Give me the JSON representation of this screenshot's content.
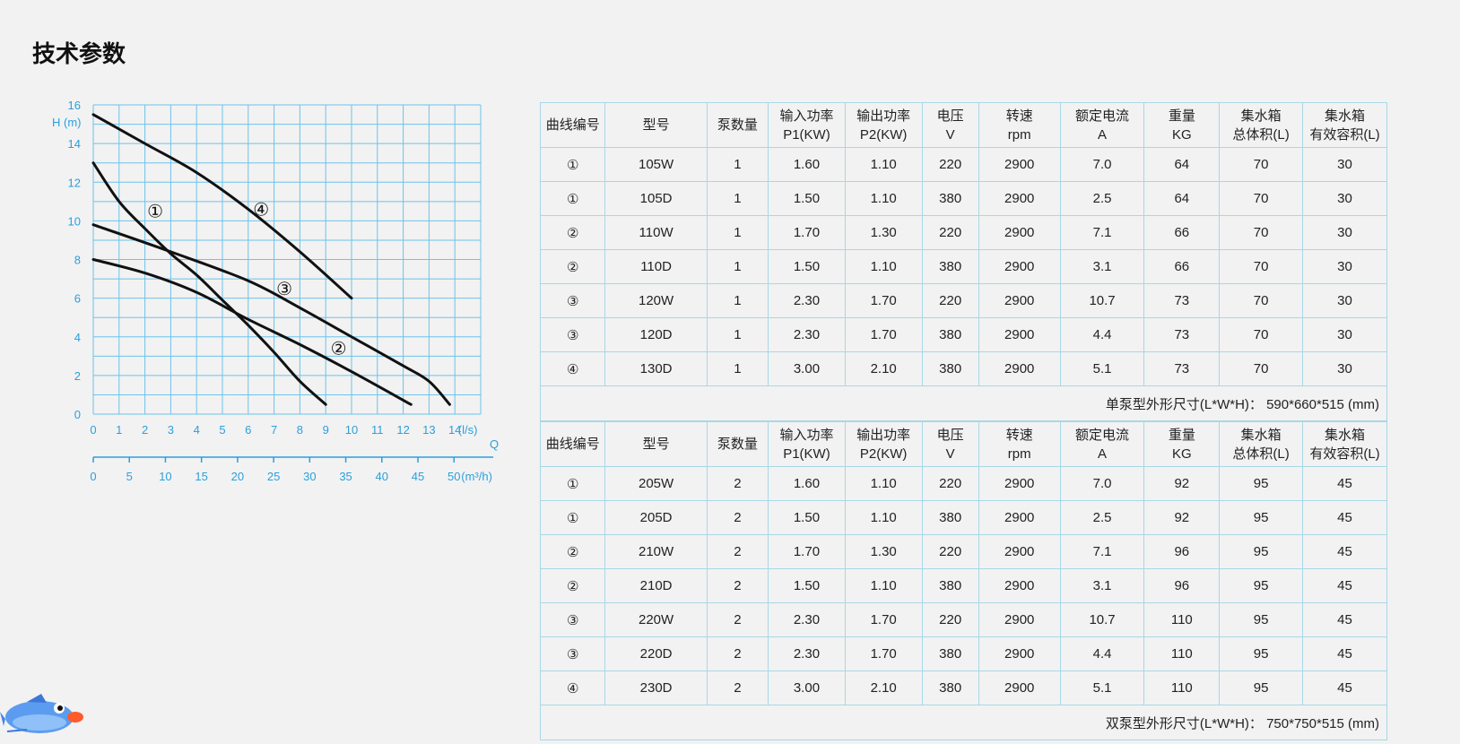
{
  "page": {
    "title": "技术参数"
  },
  "chart_data": {
    "type": "line",
    "ylabel": "H (m)",
    "xlabel": "Q",
    "x_unit_primary": "(l/s)",
    "x_unit_secondary": "(m³/h)",
    "ylim": [
      0,
      16
    ],
    "xlim": [
      0,
      15
    ],
    "x_ticks": [
      0,
      1,
      2,
      3,
      4,
      5,
      6,
      7,
      8,
      9,
      10,
      11,
      12,
      13,
      14
    ],
    "y_ticks": [
      0,
      2,
      4,
      6,
      8,
      10,
      12,
      14,
      16
    ],
    "x2_ticks": [
      0,
      5,
      10,
      15,
      20,
      25,
      30,
      35,
      40,
      45,
      50
    ],
    "grid": true,
    "series": [
      {
        "name": "①",
        "points": [
          [
            0,
            13.0
          ],
          [
            1,
            11.0
          ],
          [
            2,
            9.6
          ],
          [
            3,
            8.3
          ],
          [
            4,
            7.2
          ],
          [
            5,
            5.9
          ],
          [
            6,
            4.6
          ],
          [
            7,
            3.2
          ],
          [
            8,
            1.7
          ],
          [
            9,
            0.5
          ]
        ]
      },
      {
        "name": "②",
        "points": [
          [
            0,
            8.0
          ],
          [
            2,
            7.3
          ],
          [
            4,
            6.3
          ],
          [
            6,
            4.9
          ],
          [
            8,
            3.6
          ],
          [
            10,
            2.2
          ],
          [
            12.3,
            0.5
          ]
        ]
      },
      {
        "name": "③",
        "points": [
          [
            0,
            9.8
          ],
          [
            3,
            8.4
          ],
          [
            6,
            6.9
          ],
          [
            8,
            5.5
          ],
          [
            10,
            4.0
          ],
          [
            12,
            2.5
          ],
          [
            13,
            1.7
          ],
          [
            13.8,
            0.5
          ]
        ]
      },
      {
        "name": "④",
        "points": [
          [
            0,
            15.5
          ],
          [
            2,
            14.0
          ],
          [
            4,
            12.5
          ],
          [
            6,
            10.6
          ],
          [
            8,
            8.4
          ],
          [
            10,
            6.0
          ]
        ]
      }
    ],
    "labels": [
      {
        "text": "①",
        "at": [
          2.4,
          10.5
        ]
      },
      {
        "text": "②",
        "at": [
          9.5,
          3.4
        ]
      },
      {
        "text": "③",
        "at": [
          7.4,
          6.5
        ]
      },
      {
        "text": "④",
        "at": [
          6.5,
          10.6
        ]
      }
    ]
  },
  "table_single": {
    "headers": [
      [
        "曲线编号"
      ],
      [
        "型号"
      ],
      [
        "泵数量"
      ],
      [
        "输入功率",
        "P1(KW)"
      ],
      [
        "输出功率",
        "P2(KW)"
      ],
      [
        "电压",
        "V"
      ],
      [
        "转速",
        "rpm"
      ],
      [
        "额定电流",
        "A"
      ],
      [
        "重量",
        "KG"
      ],
      [
        "集水箱",
        "总体积(L)"
      ],
      [
        "集水箱",
        "有效容积(L)"
      ]
    ],
    "rows": [
      [
        "①",
        "105W",
        "1",
        "1.60",
        "1.10",
        "220",
        "2900",
        "7.0",
        "64",
        "70",
        "30"
      ],
      [
        "①",
        "105D",
        "1",
        "1.50",
        "1.10",
        "380",
        "2900",
        "2.5",
        "64",
        "70",
        "30"
      ],
      [
        "②",
        "110W",
        "1",
        "1.70",
        "1.30",
        "220",
        "2900",
        "7.1",
        "66",
        "70",
        "30"
      ],
      [
        "②",
        "110D",
        "1",
        "1.50",
        "1.10",
        "380",
        "2900",
        "3.1",
        "66",
        "70",
        "30"
      ],
      [
        "③",
        "120W",
        "1",
        "2.30",
        "1.70",
        "220",
        "2900",
        "10.7",
        "73",
        "70",
        "30"
      ],
      [
        "③",
        "120D",
        "1",
        "2.30",
        "1.70",
        "380",
        "2900",
        "4.4",
        "73",
        "70",
        "30"
      ],
      [
        "④",
        "130D",
        "1",
        "3.00",
        "2.10",
        "380",
        "2900",
        "5.1",
        "73",
        "70",
        "30"
      ]
    ],
    "footer": "单泵型外形尺寸(L*W*H)：  590*660*515 (mm)"
  },
  "table_double": {
    "headers": [
      [
        "曲线编号"
      ],
      [
        "型号"
      ],
      [
        "泵数量"
      ],
      [
        "输入功率",
        "P1(KW)"
      ],
      [
        "输出功率",
        "P2(KW)"
      ],
      [
        "电压",
        "V"
      ],
      [
        "转速",
        "rpm"
      ],
      [
        "额定电流",
        "A"
      ],
      [
        "重量",
        "KG"
      ],
      [
        "集水箱",
        "总体积(L)"
      ],
      [
        "集水箱",
        "有效容积(L)"
      ]
    ],
    "rows": [
      [
        "①",
        "205W",
        "2",
        "1.60",
        "1.10",
        "220",
        "2900",
        "7.0",
        "92",
        "95",
        "45"
      ],
      [
        "①",
        "205D",
        "2",
        "1.50",
        "1.10",
        "380",
        "2900",
        "2.5",
        "92",
        "95",
        "45"
      ],
      [
        "②",
        "210W",
        "2",
        "1.70",
        "1.30",
        "220",
        "2900",
        "7.1",
        "96",
        "95",
        "45"
      ],
      [
        "②",
        "210D",
        "2",
        "1.50",
        "1.10",
        "380",
        "2900",
        "3.1",
        "96",
        "95",
        "45"
      ],
      [
        "③",
        "220W",
        "2",
        "2.30",
        "1.70",
        "220",
        "2900",
        "10.7",
        "110",
        "95",
        "45"
      ],
      [
        "③",
        "220D",
        "2",
        "2.30",
        "1.70",
        "380",
        "2900",
        "4.4",
        "110",
        "95",
        "45"
      ],
      [
        "④",
        "230D",
        "2",
        "3.00",
        "2.10",
        "380",
        "2900",
        "5.1",
        "110",
        "95",
        "45"
      ]
    ],
    "footer": "双泵型外形尺寸(L*W*H)：  750*750*515 (mm)"
  },
  "decor": {
    "mascot_icon": "blue-fish-icon",
    "grid_color": "#6cc3ea",
    "axis_color": "#2aa0dc",
    "curve_color": "#111111"
  }
}
